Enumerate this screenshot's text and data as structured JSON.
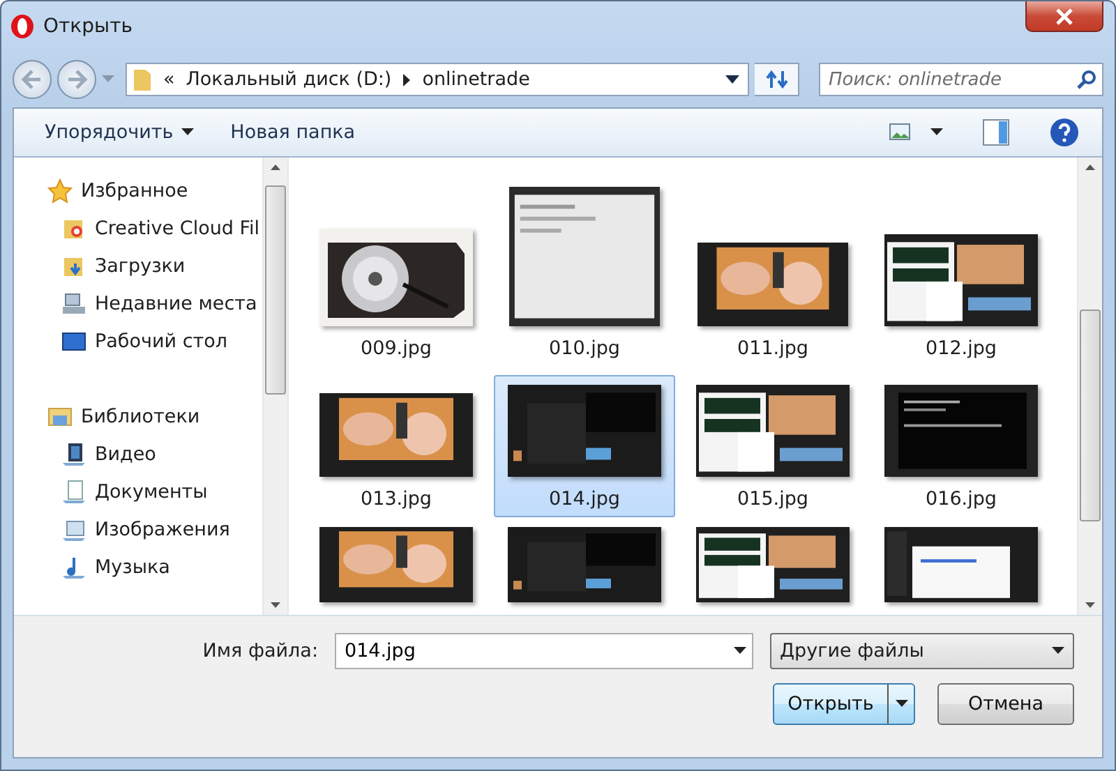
{
  "window": {
    "title": "Открыть"
  },
  "nav": {
    "prefix": "«",
    "path": [
      "Локальный диск (D:)",
      "onlinetrade"
    ],
    "search": {
      "placeholder": "Поиск: onlinetrade"
    }
  },
  "toolbar": {
    "organize": "Упорядочить",
    "new_folder": "Новая папка"
  },
  "sidebar": {
    "groups": [
      {
        "label": "Избранное",
        "kind": "favorites",
        "children": [
          {
            "label": "Creative Cloud Fil",
            "kind": "cloud-folder"
          },
          {
            "label": "Загрузки",
            "kind": "downloads"
          },
          {
            "label": "Недавние места",
            "kind": "recent"
          },
          {
            "label": "Рабочий стол",
            "kind": "desktop"
          }
        ]
      },
      {
        "label": "Библиотеки",
        "kind": "libraries",
        "children": [
          {
            "label": "Видео",
            "kind": "video"
          },
          {
            "label": "Документы",
            "kind": "documents"
          },
          {
            "label": "Изображения",
            "kind": "pictures"
          },
          {
            "label": "Музыка",
            "kind": "music"
          }
        ]
      }
    ]
  },
  "files": [
    {
      "name": "009.jpg",
      "selected": false
    },
    {
      "name": "010.jpg",
      "selected": false
    },
    {
      "name": "011.jpg",
      "selected": false
    },
    {
      "name": "012.jpg",
      "selected": false
    },
    {
      "name": "013.jpg",
      "selected": false
    },
    {
      "name": "014.jpg",
      "selected": true
    },
    {
      "name": "015.jpg",
      "selected": false
    },
    {
      "name": "016.jpg",
      "selected": false
    },
    {
      "selected": false
    },
    {
      "selected": false
    },
    {
      "selected": false
    },
    {
      "selected": false
    }
  ],
  "footer": {
    "filename_label": "Имя файла:",
    "filename": "014.jpg",
    "filter": "Другие файлы",
    "buttons": [
      {
        "label": "Открыть",
        "kind": "split"
      },
      {
        "label": "Отмена",
        "kind": "plain"
      }
    ]
  }
}
